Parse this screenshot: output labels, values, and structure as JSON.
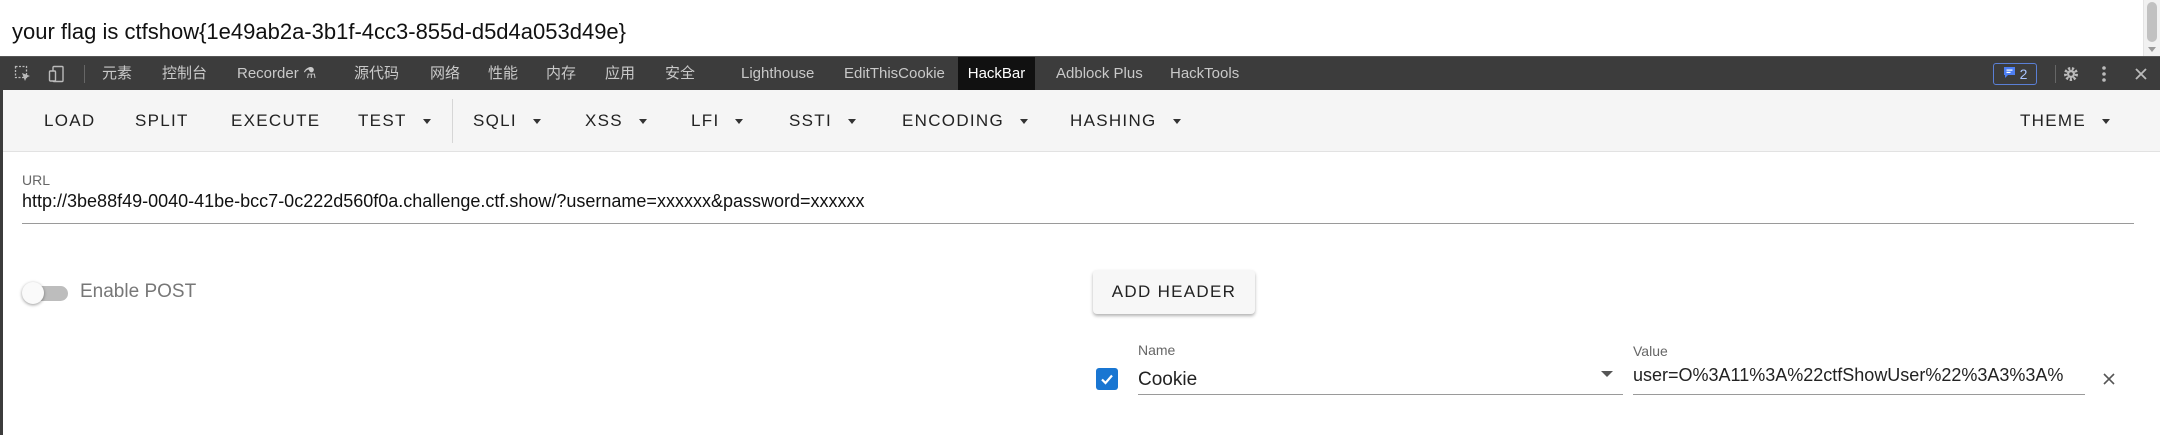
{
  "page": {
    "flag_text": "your flag is ctfshow{1e49ab2a-3b1f-4cc3-855d-d5d4a053d49e}"
  },
  "devtools": {
    "tabs": [
      {
        "label": "元素"
      },
      {
        "label": "控制台"
      },
      {
        "label": "Recorder ⚗"
      },
      {
        "label": "源代码"
      },
      {
        "label": "网络"
      },
      {
        "label": "性能"
      },
      {
        "label": "内存"
      },
      {
        "label": "应用"
      },
      {
        "label": "安全"
      },
      {
        "label": "Lighthouse"
      },
      {
        "label": "EditThisCookie"
      },
      {
        "label": "HackBar"
      },
      {
        "label": "Adblock Plus"
      },
      {
        "label": "HackTools"
      }
    ],
    "active_tab": "HackBar",
    "issues_count": "2",
    "icons": [
      "inspect-icon",
      "device-toggle-icon",
      "issues-icon",
      "settings-icon",
      "more-icon",
      "close-icon"
    ]
  },
  "hackbar": {
    "toolbar": {
      "load": "LOAD",
      "split": "SPLIT",
      "execute": "EXECUTE",
      "test": "TEST",
      "sqli": "SQLI",
      "xss": "XSS",
      "lfi": "LFI",
      "ssti": "SSTI",
      "encoding": "ENCODING",
      "hashing": "HASHING",
      "theme": "THEME"
    },
    "url": {
      "label": "URL",
      "value": "http://3be88f49-0040-41be-bcc7-0c222d560f0a.challenge.ctf.show/?username=xxxxxx&password=xxxxxx"
    },
    "post": {
      "label": "Enable POST",
      "enabled": false
    },
    "add_header_label": "ADD HEADER",
    "header": {
      "checked": true,
      "name_label": "Name",
      "name_value": "Cookie",
      "value_label": "Value",
      "value": "user=O%3A11%3A%22ctfShowUser%22%3A3%3A%"
    },
    "colors": {
      "accent": "#1976d2",
      "devtools_bg": "#3c3c3c",
      "active_tab_bg": "#111111"
    }
  }
}
